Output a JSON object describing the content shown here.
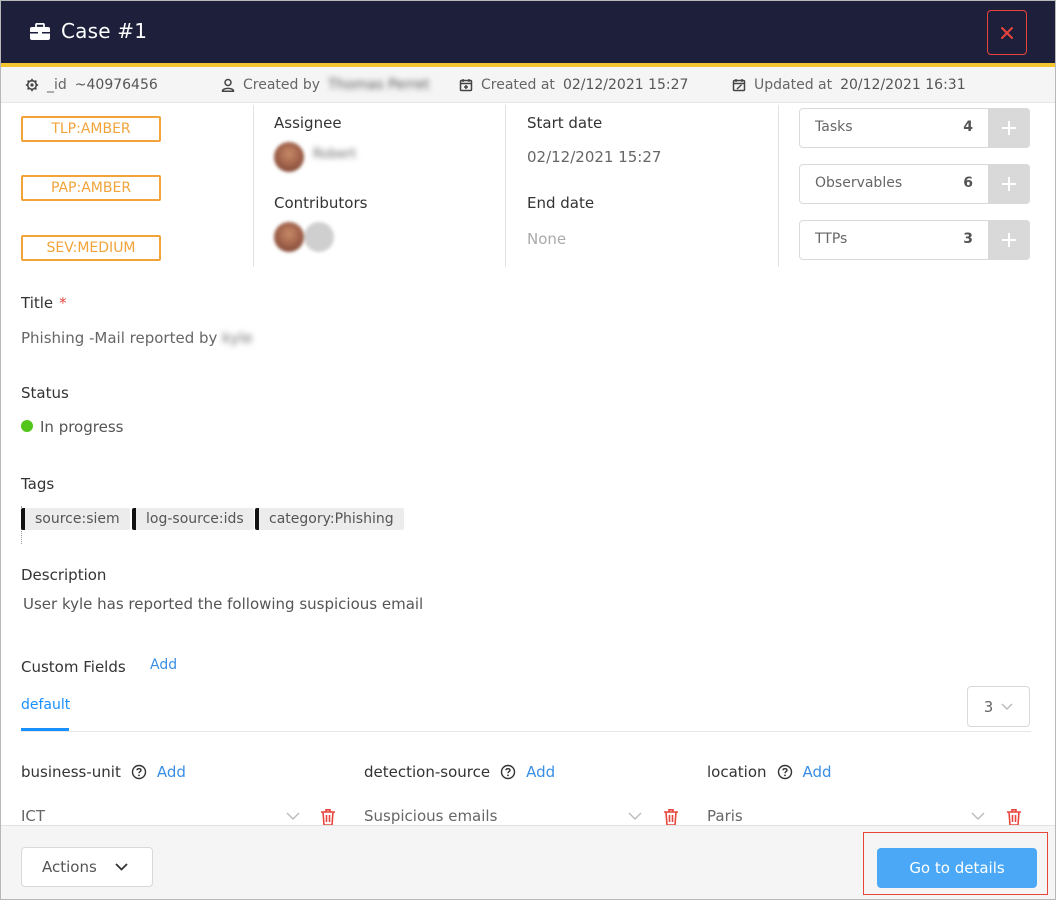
{
  "header": {
    "title": "Case #1",
    "icon": "briefcase-icon",
    "close_icon": "close-icon"
  },
  "meta": {
    "id_label": "_id",
    "id_value": "~40976456",
    "created_by_label": "Created by",
    "created_by_value": "Thomas Perret",
    "created_at_label": "Created at",
    "created_at_value": "02/12/2021 15:27",
    "updated_at_label": "Updated at",
    "updated_at_value": "20/12/2021 16:31"
  },
  "pills": [
    "TLP:AMBER",
    "PAP:AMBER",
    "SEV:MEDIUM"
  ],
  "assignee": {
    "label": "Assignee",
    "name": "Robert"
  },
  "contributors": {
    "label": "Contributors"
  },
  "dates": {
    "start_label": "Start date",
    "start_value": "02/12/2021 15:27",
    "end_label": "End date",
    "end_value": "None"
  },
  "counters": [
    {
      "label": "Tasks",
      "count": "4"
    },
    {
      "label": "Observables",
      "count": "6"
    },
    {
      "label": "TTPs",
      "count": "3"
    }
  ],
  "title_field": {
    "label": "Title",
    "required_mark": "*",
    "value": "Phishing -Mail reported by",
    "value_blurred": "kyle"
  },
  "status_field": {
    "label": "Status",
    "value": "In progress",
    "color": "#52c41a"
  },
  "tags_field": {
    "label": "Tags",
    "tags": [
      "source:siem",
      "log-source:ids",
      "category:Phishing"
    ]
  },
  "description_field": {
    "label": "Description",
    "value": "User kyle has reported the following suspicious email"
  },
  "custom_fields": {
    "label": "Custom Fields",
    "add_label": "Add",
    "tab_default": "default",
    "page_value": "3",
    "fields": [
      {
        "name": "business-unit",
        "add_label": "Add",
        "value": "ICT"
      },
      {
        "name": "detection-source",
        "add_label": "Add",
        "value": "Suspicious emails"
      },
      {
        "name": "location",
        "add_label": "Add",
        "value": "Paris"
      }
    ]
  },
  "footer": {
    "actions_label": "Actions",
    "goto_label": "Go to details"
  },
  "colors": {
    "header_bg": "#1e1f3b",
    "accent_bar": "#f2c531",
    "pill": "#f2a33a",
    "primary": "#4aa8f7",
    "link": "#3a8ee6",
    "danger": "#e8453c"
  }
}
